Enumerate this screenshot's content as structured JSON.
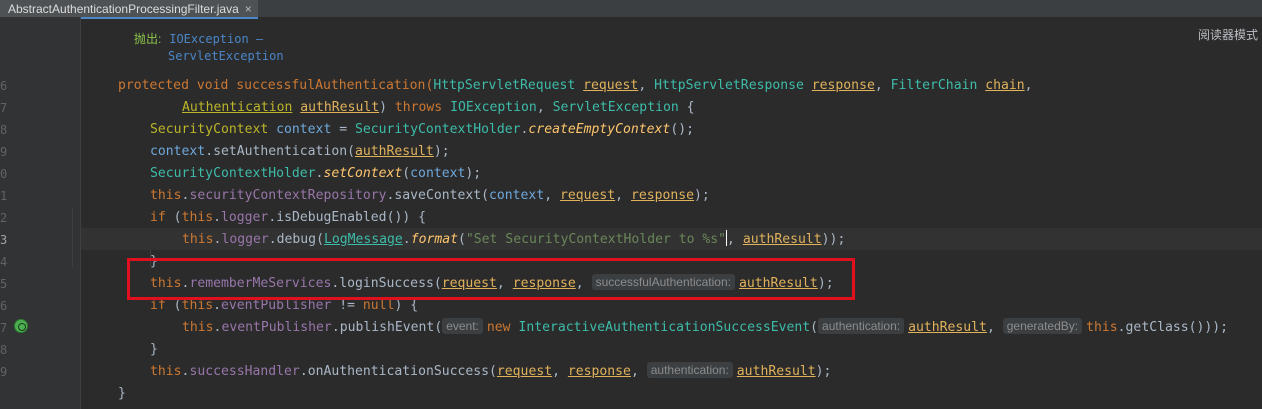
{
  "tab": {
    "filename": "AbstractAuthenticationProcessingFilter.java",
    "close_icon": "×"
  },
  "reader_mode": "阅读器模式",
  "doc": {
    "label": "抛出:",
    "throws1": "IOException –",
    "throws2": "ServletException"
  },
  "line_numbers": [
    "6",
    "7",
    "8",
    "9",
    "0",
    "1",
    "2",
    "3",
    "4",
    "5",
    "6",
    "7",
    "8",
    "9"
  ],
  "code": {
    "l1_sig": "protected void successfulAuthentication(",
    "hsr": "HttpServletRequest",
    "request": "request",
    "hsresp": "HttpServletResponse",
    "response": "response",
    "fc": "FilterChain",
    "chain": "chain",
    "auth_type": "Authentication",
    "authResult": "authResult",
    "throws": "throws",
    "ioe": "IOException",
    "se": "ServletException",
    "sc": "SecurityContext",
    "context": "context",
    "sch": "SecurityContextHolder",
    "createEmptyContext": "createEmptyContext",
    "setAuthentication": "setAuthentication",
    "setContext": "setContext",
    "this": "this",
    "scr": "securityContextRepository",
    "saveContext": "saveContext",
    "if": "if",
    "logger": "logger",
    "isDebugEnabled": "isDebugEnabled",
    "debug": "debug",
    "logMessage": "LogMessage",
    "format": "format",
    "str": "\"Set SecurityContextHolder to %s\"",
    "rms": "rememberMeServices",
    "loginSuccess": "loginSuccess",
    "hint_sa": "successfulAuthentication:",
    "eventPublisher": "eventPublisher",
    "null": "null",
    "publishEvent": "publishEvent",
    "hint_event": "event:",
    "new": "new",
    "iase": "InteractiveAuthenticationSuccessEvent",
    "hint_auth": "authentication:",
    "hint_gen": "generatedBy:",
    "getClass": "getClass",
    "successHandler": "successHandler",
    "onAuthSuccess": "onAuthenticationSuccess",
    "void_kw": "void"
  }
}
